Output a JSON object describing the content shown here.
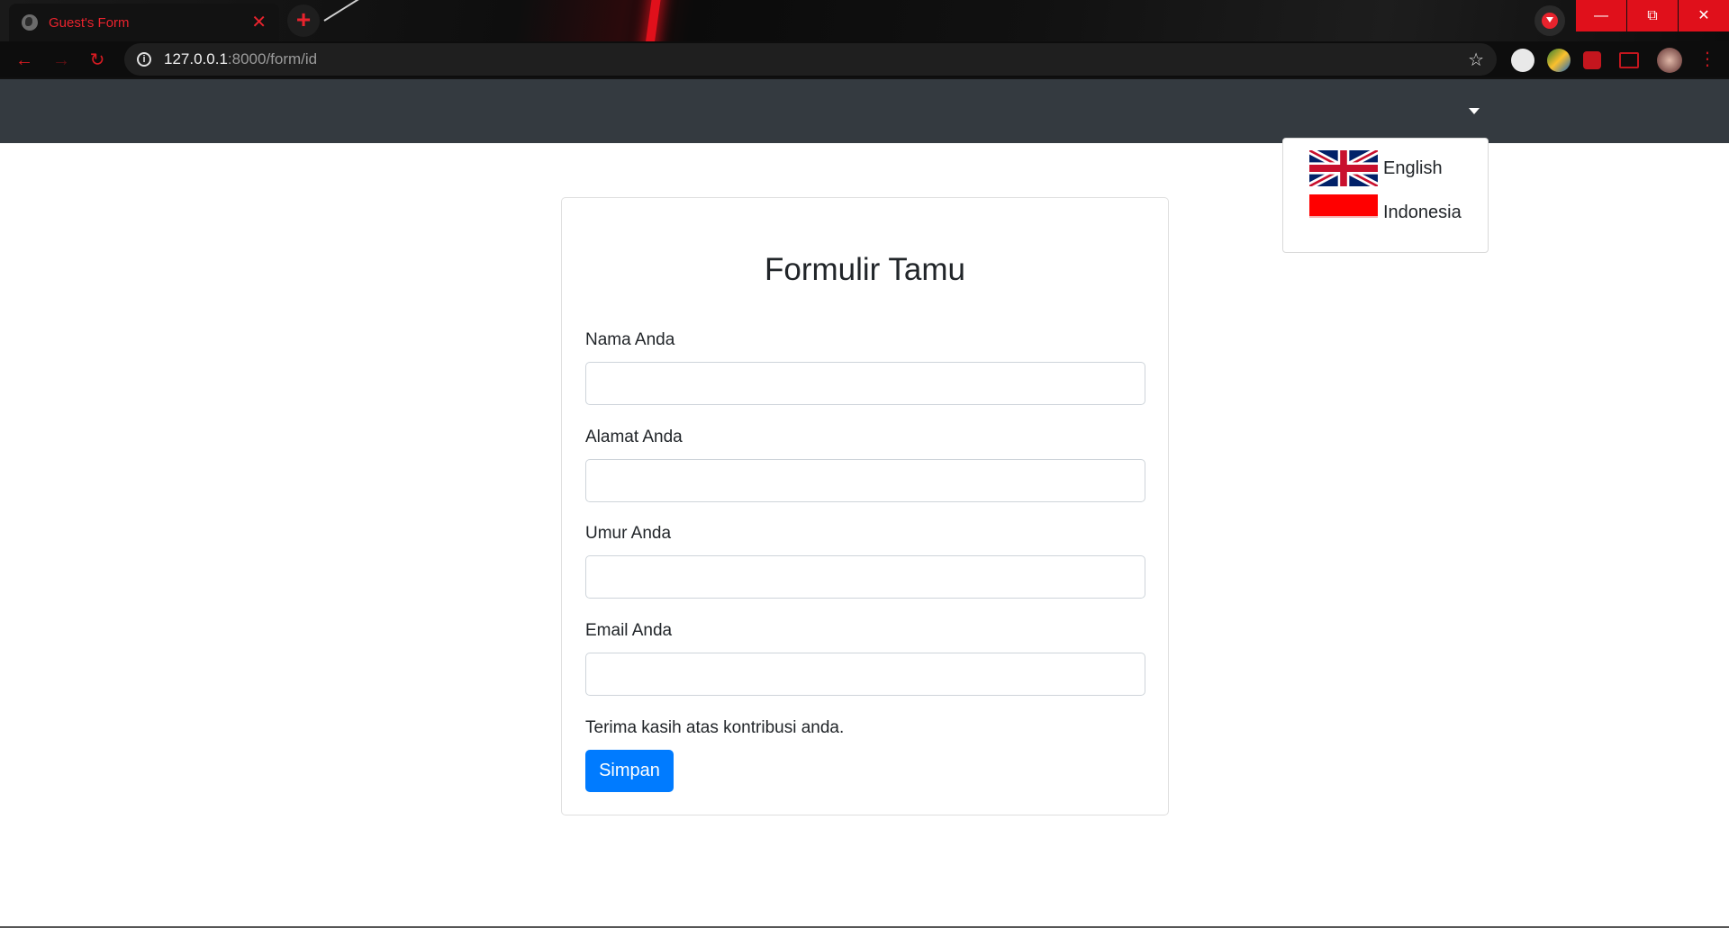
{
  "browser": {
    "tab_title": "Guest's Form",
    "tab_close": "✕",
    "new_tab": "+",
    "url_host": "127.0.0.1",
    "url_path": ":8000/form/id",
    "window_controls": [
      "minimize-icon",
      "restore-icon",
      "close-icon"
    ],
    "accent": "#e0101b"
  },
  "navbar": {
    "background": "#343a40"
  },
  "language_menu": {
    "items": [
      {
        "label": "English",
        "flag": "uk-flag-icon"
      },
      {
        "label": "Indonesia",
        "flag": "indonesia-flag-icon"
      }
    ]
  },
  "form": {
    "title": "Formulir Tamu",
    "fields": [
      {
        "label": "Nama Anda",
        "value": ""
      },
      {
        "label": "Alamat Anda",
        "value": ""
      },
      {
        "label": "Umur Anda",
        "value": ""
      },
      {
        "label": "Email Anda",
        "value": ""
      }
    ],
    "thanks_text": "Terima kasih atas kontribusi anda.",
    "submit_label": "Simpan",
    "submit_color": "#007bff"
  }
}
